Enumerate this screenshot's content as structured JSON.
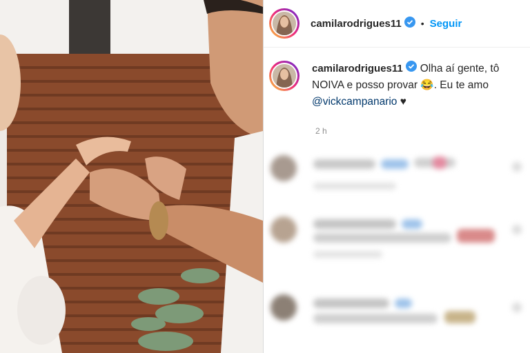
{
  "header": {
    "username": "camilarodrigues11",
    "dot": "•",
    "follow_label": "Seguir"
  },
  "caption": {
    "username": "camilarodrigues11",
    "text": "Olha aí gente, tô NOIVA e posso provar",
    "emoji": "😂",
    "text_after": ". Eu te amo",
    "mention": "@vickcampanario",
    "heart": "♥",
    "time": "2 h"
  },
  "colors": {
    "accent": "#0095f6",
    "verified": "#3897f0",
    "text": "#262626",
    "muted": "#8e8e8e"
  },
  "icons": {
    "verified": "verified-badge-icon"
  }
}
